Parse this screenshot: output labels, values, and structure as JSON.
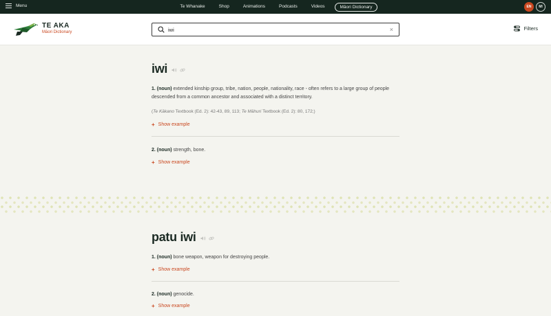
{
  "topbar": {
    "menu_label": "Menu",
    "nav": [
      "Te Whanake",
      "Shop",
      "Animations",
      "Podcasts",
      "Videos"
    ],
    "nav_active": "Māori Dictionary",
    "lang_en": "EN",
    "lang_mi": "MI"
  },
  "header": {
    "brand": "TE AKA",
    "subtitle": "Māori Dictionary",
    "search_value": "iwi",
    "filters_label": "Filters"
  },
  "entries": [
    {
      "headword": "iwi",
      "senses": [
        {
          "num": "1.",
          "pos": "(noun)",
          "definition": "extended kinship group, tribe, nation, people, nationality, race - often refers to a large group of people descended from a common ancestor and associated with a distinct territory.",
          "source_open": "(",
          "source_book1": "Te Kākano",
          "source_ref1": " Textbook (Ed. 2): 42-43, 89, 113; ",
          "source_book2": "Te Māhuri",
          "source_ref2": " Textbook (Ed. 2): 80, 172;)",
          "show_example": "Show example"
        },
        {
          "num": "2.",
          "pos": "(noun)",
          "definition": "strength, bone.",
          "show_example": "Show example"
        }
      ]
    },
    {
      "headword": "patu iwi",
      "senses": [
        {
          "num": "1.",
          "pos": "(noun)",
          "definition": "bone weapon, weapon for destroying people.",
          "show_example": "Show example"
        },
        {
          "num": "2.",
          "pos": "(noun)",
          "definition": "genocide.",
          "show_example": "Show example"
        }
      ]
    }
  ],
  "colors": {
    "accent": "#c9471f",
    "topbar": "#15261f",
    "background": "#f4f4ef"
  },
  "icons": [
    "menu-icon",
    "search-icon",
    "clear-icon",
    "filters-icon",
    "audio-icon",
    "link-icon",
    "plus-icon",
    "bird-logo"
  ]
}
